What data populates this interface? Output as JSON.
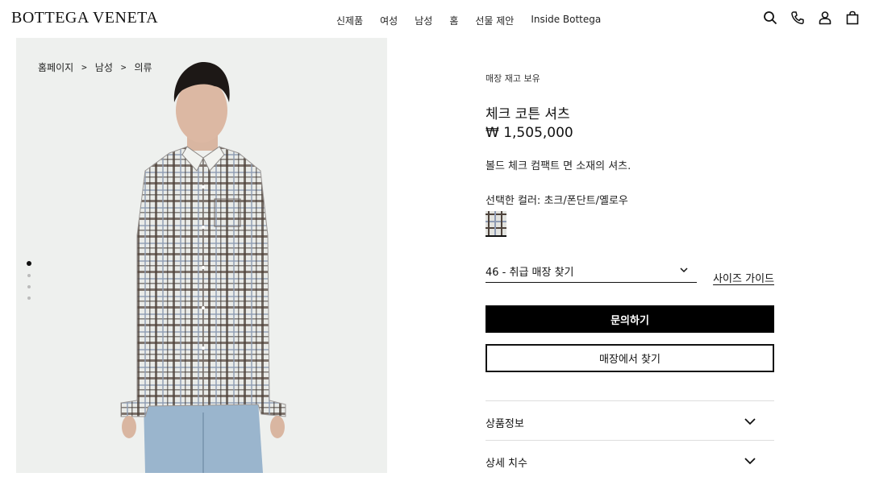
{
  "brand": {
    "logo_text": "BOTTEGA VENETA"
  },
  "nav": {
    "items": [
      "신제품",
      "여성",
      "남성",
      "홈",
      "선물 제안",
      "Inside Bottega"
    ]
  },
  "header_icons": [
    "search-icon",
    "phone-icon",
    "account-icon",
    "bag-icon"
  ],
  "breadcrumb": {
    "items": [
      "홈페이지",
      "남성",
      "의류"
    ],
    "separator": ">"
  },
  "gallery": {
    "slide_count": 4,
    "active_index": 0,
    "background": "#eef0ee"
  },
  "product": {
    "availability": "매장 재고 보유",
    "name": "체크 코튼 셔츠",
    "price": "₩ 1,505,000",
    "description": "볼드 체크 컴팩트 면 소재의 셔츠.",
    "selected_color_label": "선택한 컬러: 초크/폰단트/옐로우",
    "size_select_value": "46 - 취급 매장 찾기",
    "size_guide_label": "사이즈 가이드",
    "primary_button": "문의하기",
    "secondary_button": "매장에서 찾기",
    "accordions": [
      "상품정보",
      "상세 치수"
    ]
  },
  "colors": {
    "primary_button_bg": "#000000",
    "text": "#111111",
    "divider": "#dddddd"
  }
}
